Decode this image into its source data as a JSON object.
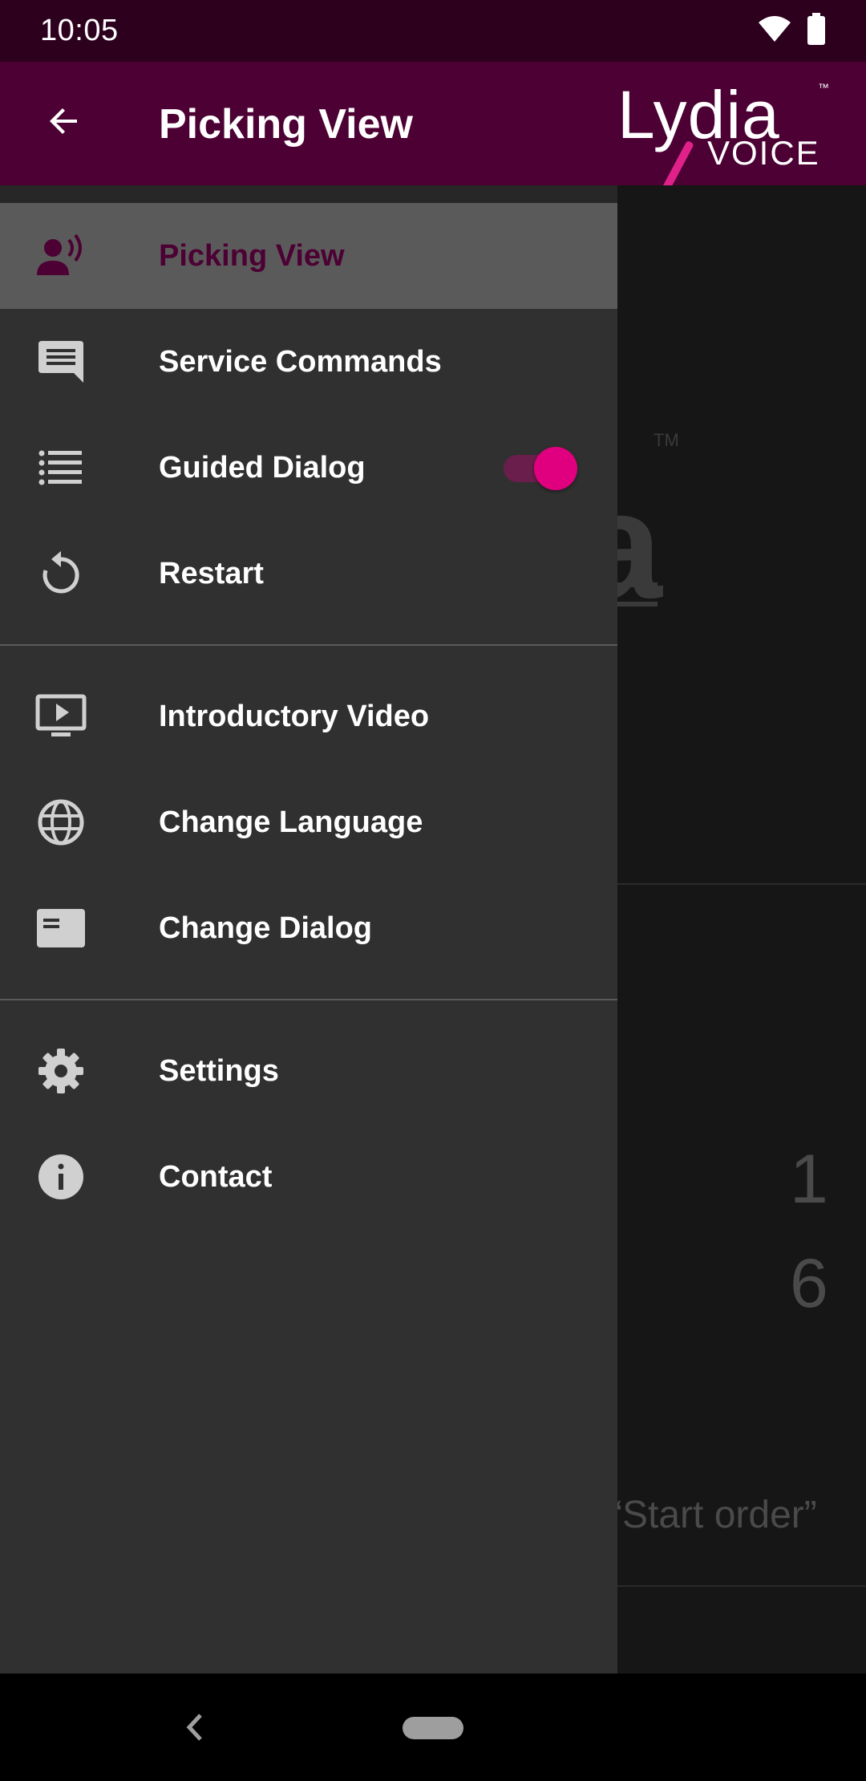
{
  "status_bar": {
    "time": "10:05",
    "icons": [
      "wifi-icon",
      "battery-icon"
    ]
  },
  "app_bar": {
    "title": "Picking View",
    "back_icon": "arrow-left-icon",
    "logo": {
      "main": "Lydia",
      "sub": "VOICE",
      "tm": "™"
    }
  },
  "background": {
    "logo_letter": "a",
    "logo_tm": "TM",
    "numbers": [
      "1",
      "6"
    ],
    "command_hint": "“Start order”"
  },
  "drawer": {
    "groups": [
      {
        "items": [
          {
            "label": "Picking View",
            "icon": "voice-user-icon",
            "active": true
          },
          {
            "label": "Service Commands",
            "icon": "message-icon"
          },
          {
            "label": "Guided Dialog",
            "icon": "list-icon",
            "toggle": true
          },
          {
            "label": "Restart",
            "icon": "restart-icon"
          }
        ]
      },
      {
        "items": [
          {
            "label": "Introductory Video",
            "icon": "video-icon"
          },
          {
            "label": "Change Language",
            "icon": "globe-icon"
          },
          {
            "label": "Change Dialog",
            "icon": "card-icon"
          }
        ]
      },
      {
        "items": [
          {
            "label": "Settings",
            "icon": "gear-icon"
          },
          {
            "label": "Contact",
            "icon": "info-icon"
          }
        ]
      }
    ]
  },
  "colors": {
    "brand": "#4c0033",
    "accent": "#e0007f",
    "drawer_bg": "#303030"
  }
}
